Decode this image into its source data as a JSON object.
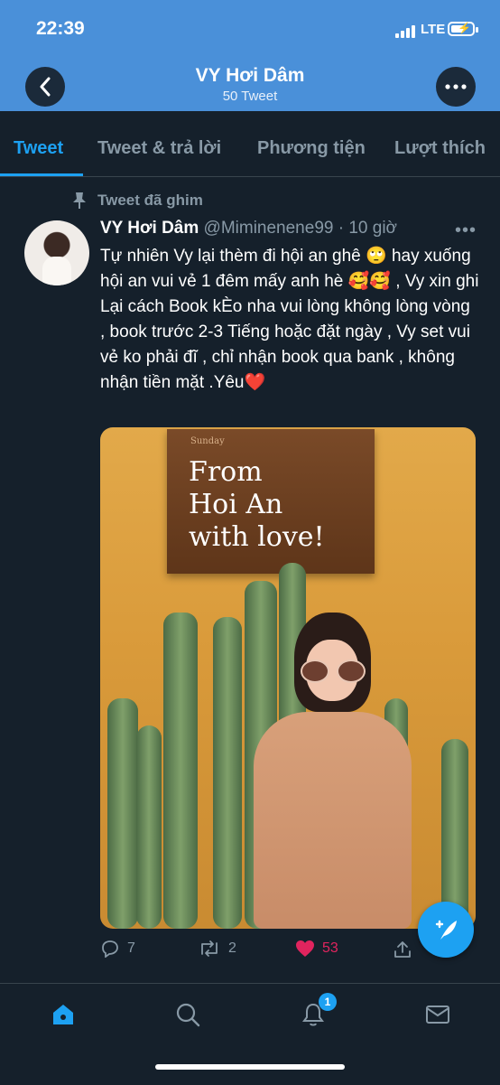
{
  "status_bar": {
    "time": "22:39",
    "network": "LTE"
  },
  "header": {
    "title": "VY Hơi Dâm",
    "subtitle": "50 Tweet"
  },
  "tabs": [
    {
      "label": "Tweet",
      "active": true
    },
    {
      "label": "Tweet & trả lời",
      "active": false
    },
    {
      "label": "Phương tiện",
      "active": false
    },
    {
      "label": "Lượt thích",
      "active": false
    }
  ],
  "tweet": {
    "pinned_label": "Tweet đã ghim",
    "display_name": "VY Hơi Dâm",
    "handle": "@Miminenene99",
    "time": "· 10 giờ",
    "text": "Tự nhiên Vy lại thèm đi hội an ghê 🙄 hay xuống hội an vui vẻ 1 đêm mấy anh hè 🥰🥰 , Vy xin ghi Lại cách Book kÈo nha vui lòng không lòng vòng , book trước 2-3 Tiếng hoặc đặt ngày , Vy set vui vẻ ko phải đĩ , chỉ nhận book qua bank , không nhận tiền mặt .Yêu❤️",
    "media": {
      "sign_small": "Sunday",
      "sign_line1": "From",
      "sign_line2": "Hoi An",
      "sign_line3": "with love!"
    },
    "replies": "7",
    "retweets": "2",
    "likes": "53",
    "liked": true
  },
  "bottom_nav": {
    "notifications_badge": "1"
  },
  "colors": {
    "accent": "#1da1f2",
    "header": "#4a90d9",
    "background": "#15202b",
    "like": "#e0245e"
  }
}
